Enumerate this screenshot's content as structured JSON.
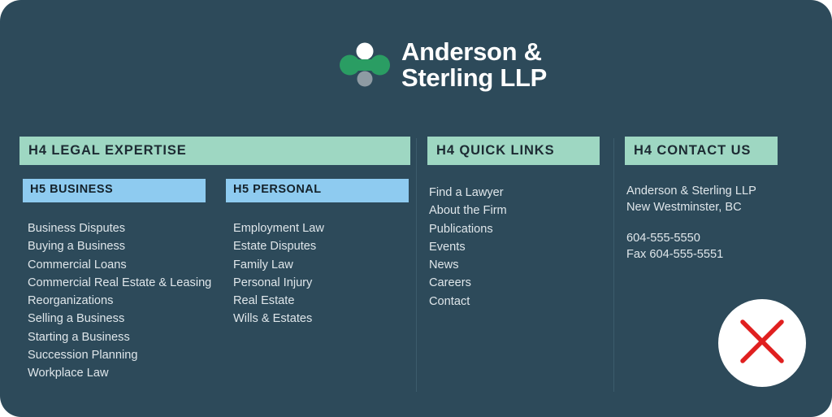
{
  "brand": {
    "name_line1": "Anderson &",
    "name_line2": "Sterling LLP",
    "mark_icon": "two-circles-connected-logo-icon",
    "colors": {
      "panel_bg": "#2d4a5a",
      "h4_bg": "#9ed7c2",
      "h5_bg": "#8ecbf0",
      "text": "#dfe6ea",
      "accent_green": "#2a9d63",
      "accent_gray": "#8e9ba3",
      "close_red": "#e02020"
    }
  },
  "columns": {
    "expertise": {
      "heading": "H4 LEGAL EXPERTISE",
      "groups": [
        {
          "subheading": "H5 BUSINESS",
          "items": [
            "Business Disputes",
            "Buying a Business",
            "Commercial Loans",
            "Commercial Real Estate & Leasing",
            "Reorganizations",
            "Selling a Business",
            "Starting a Business",
            "Succession Planning",
            "Workplace Law"
          ]
        },
        {
          "subheading": "H5 PERSONAL",
          "items": [
            "Employment Law",
            "Estate Disputes",
            "Family Law",
            "Personal Injury",
            "Real Estate",
            "Wills & Estates"
          ]
        }
      ]
    },
    "quick_links": {
      "heading": "H4 QUICK LINKS",
      "items": [
        "Find a Lawyer",
        "About the Firm",
        "Publications",
        "Events",
        "News",
        "Careers",
        "Contact"
      ]
    },
    "contact": {
      "heading": "H4 CONTACT US",
      "address_line1": "Anderson & Sterling LLP",
      "address_line2": "New Westminster, BC",
      "phone": "604-555-5550",
      "fax": "Fax 604-555-5551"
    }
  },
  "close_button": {
    "icon": "close-x-icon",
    "label": ""
  }
}
